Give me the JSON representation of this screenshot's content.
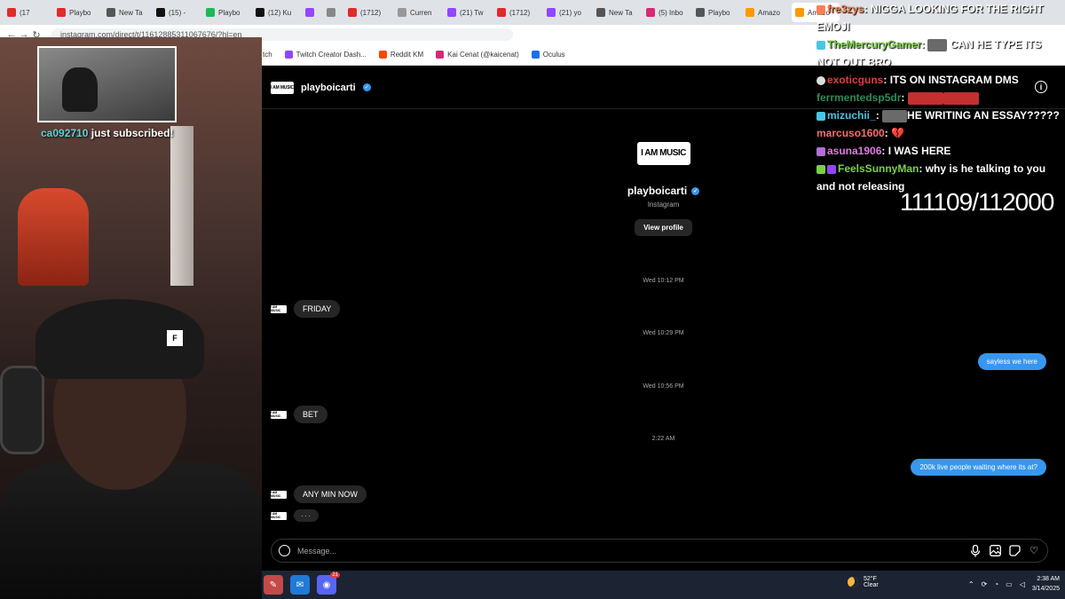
{
  "browser": {
    "tabs": [
      {
        "label": "(17",
        "color": "#e02b2b"
      },
      {
        "label": "Playbo",
        "color": "#e02b2b"
      },
      {
        "label": "New Ta",
        "color": "#555555"
      },
      {
        "label": "(15) -",
        "color": "#111111"
      },
      {
        "label": "Playbo",
        "color": "#1db954"
      },
      {
        "label": "(12) Ku",
        "color": "#111111"
      },
      {
        "label": "",
        "color": "#9146ff"
      },
      {
        "label": "",
        "color": "#888888"
      },
      {
        "label": "(1712)",
        "color": "#e02b2b"
      },
      {
        "label": "Curren",
        "color": "#999999"
      },
      {
        "label": "(21) Tw",
        "color": "#9146ff"
      },
      {
        "label": "(1712)",
        "color": "#e02b2b"
      },
      {
        "label": "(21) yo",
        "color": "#9146ff"
      },
      {
        "label": "New Ta",
        "color": "#555555"
      },
      {
        "label": "(5) Inbo",
        "color": "#d62976"
      },
      {
        "label": "Playbo",
        "color": "#555555"
      },
      {
        "label": "Amazo",
        "color": "#ff9900"
      },
      {
        "label": "Amazo",
        "color": "#ff9900"
      }
    ],
    "url": "instagram.com/direct/t/11612885311067676/?hl=en",
    "bookmarks": [
      {
        "label": "tch",
        "color": ""
      },
      {
        "label": "Twitch Creator Dash...",
        "color": "#9146ff"
      },
      {
        "label": "Reddit KM",
        "color": "#ff4500"
      },
      {
        "label": "Kai Cenat (@kaicenat)",
        "color": "#d62976"
      },
      {
        "label": "Oculus",
        "color": "#1c6ef2"
      }
    ]
  },
  "dm": {
    "header_name": "playboicarti",
    "avatar_text": "I AM MUSIC",
    "profile_name": "playboicarti",
    "profile_sub": "Instagram",
    "view_profile_label": "View profile",
    "timestamps": [
      "Wed 10:12 PM",
      "Wed 10:29 PM",
      "Wed 10:56 PM",
      "2:22 AM"
    ],
    "messages_in": [
      "FRIDAY",
      "BET",
      "ANY MIN NOW"
    ],
    "typing": "···",
    "messages_out": [
      "sayless we here",
      "200k live people waiting where its at?"
    ],
    "composer_placeholder": "Message..."
  },
  "taskbar": {
    "temperature": "52°F",
    "condition": "Clear",
    "time": "2:38 AM",
    "date": "3/14/2025",
    "discord_badge": "21"
  },
  "stream": {
    "sub_user": "ca092710",
    "sub_text": "just subscribed!",
    "cap_logo": "F",
    "sub_goal": "111109/112000"
  },
  "chat": [
    {
      "user": "fre3zys",
      "color": "#ff7f50",
      "text": "NIGGA LOOKING FOR THE RIGHT EMOJI"
    },
    {
      "user": "TheMercuryGamer",
      "color": "#7ad148",
      "text": "CAN HE TYPE ITS NOT OUT BRO"
    },
    {
      "user": "exoticguns",
      "color": "#e23b3b",
      "text": "ITS ON INSTAGRAM DMS"
    },
    {
      "user": "ferrmentedsp5dr",
      "color": "#2e8b57",
      "text": ""
    },
    {
      "user": "mizuchii_",
      "color": "#49c6e5",
      "text": "HE WRITING AN ESSAY?????"
    },
    {
      "user": "marcuso1600",
      "color": "#ff6b6b",
      "text": "💔"
    },
    {
      "user": "asuna1906",
      "color": "#e07be0",
      "text": "I WAS HERE"
    },
    {
      "user": "FeelsSunnyMan",
      "color": "#7ad148",
      "text": "why is he talking to you and not releasing"
    }
  ]
}
